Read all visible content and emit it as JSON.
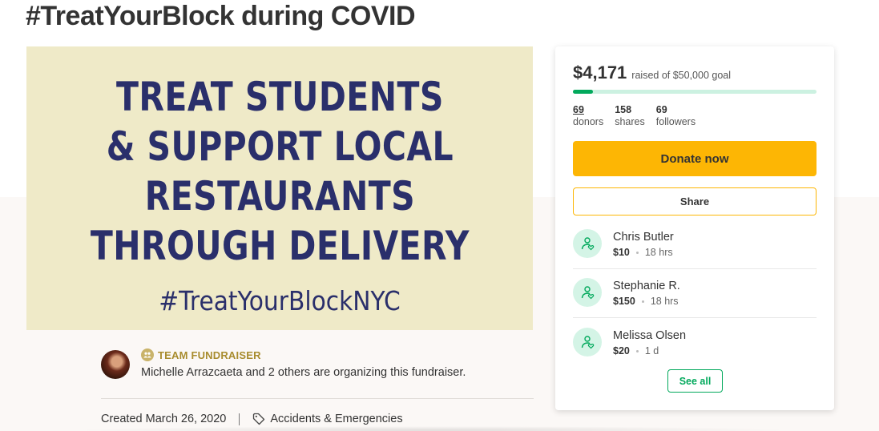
{
  "page": {
    "title": "#TreatYourBlock during COVID"
  },
  "hero": {
    "headline_lines": [
      "TREAT STUDENTS",
      "& SUPPORT LOCAL",
      "RESTAURANTS",
      "THROUGH DELIVERY"
    ],
    "hashtag": "#TreatYourBlockNYC",
    "background_color": "#efeac8",
    "text_color": "#2a2f6b"
  },
  "organizer": {
    "team_label": "TEAM FUNDRAISER",
    "text": "Michelle Arrazcaeta and 2 others are organizing this fundraiser."
  },
  "meta": {
    "created": "Created March 26, 2020",
    "category": "Accidents & Emergencies"
  },
  "sidebar": {
    "raised_amount": "$4,171",
    "raised_goal_text": "raised of $50,000 goal",
    "progress_fraction": 0.0834,
    "stats": [
      {
        "num": "69",
        "label": "donors",
        "underline": true
      },
      {
        "num": "158",
        "label": "shares",
        "underline": false
      },
      {
        "num": "69",
        "label": "followers",
        "underline": false
      }
    ],
    "donate_label": "Donate now",
    "share_label": "Share",
    "donations": [
      {
        "name": "Chris Butler",
        "amount": "$10",
        "time": "18 hrs"
      },
      {
        "name": "Stephanie R.",
        "amount": "$150",
        "time": "18 hrs"
      },
      {
        "name": "Melissa Olsen",
        "amount": "$20",
        "time": "1 d"
      }
    ],
    "see_all_label": "See all"
  },
  "colors": {
    "accent_green": "#02a95c",
    "donate_yellow": "#fdb604",
    "team_gold": "#a88c2e"
  }
}
